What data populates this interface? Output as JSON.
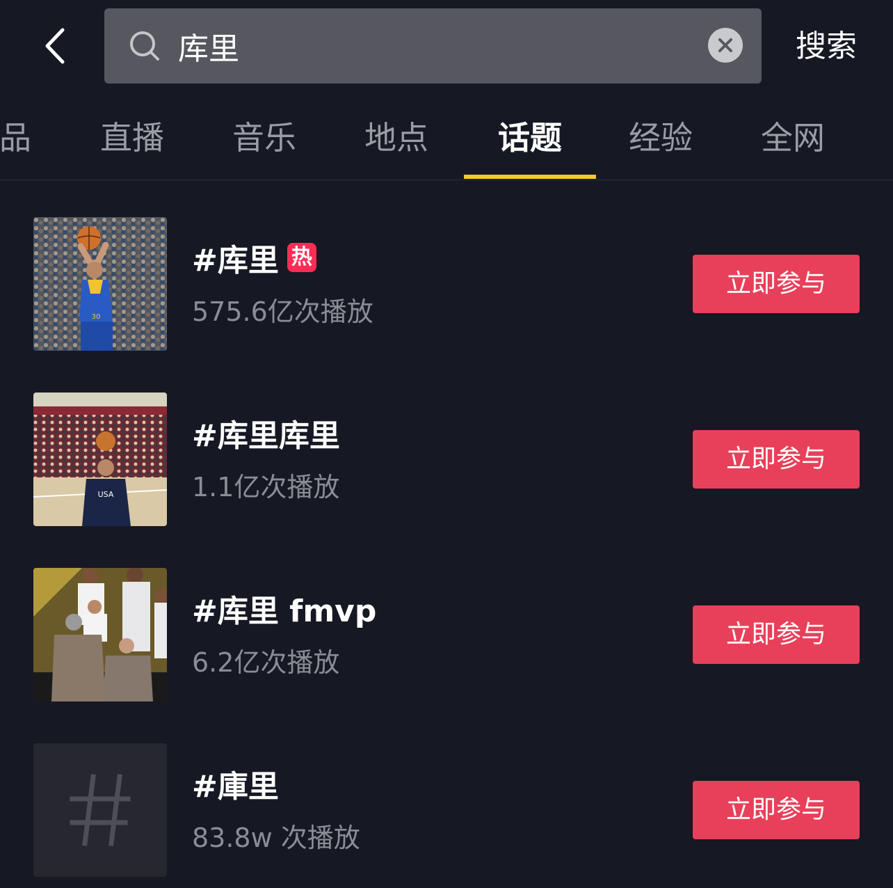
{
  "header": {
    "back_icon": "chevron-left-icon",
    "search_icon": "search-icon",
    "search_value": "库里",
    "clear_icon": "close-circle-icon",
    "submit_label": "搜索"
  },
  "tabs": [
    {
      "label": "品",
      "active": false
    },
    {
      "label": "直播",
      "active": false
    },
    {
      "label": "音乐",
      "active": false
    },
    {
      "label": "地点",
      "active": false
    },
    {
      "label": "话题",
      "active": true
    },
    {
      "label": "经验",
      "active": false
    },
    {
      "label": "全网",
      "active": false
    }
  ],
  "accent": "#f5cb2b",
  "button_color": "#e8405a",
  "topics": [
    {
      "title": "#库里",
      "hot_badge": "热",
      "plays": "575.6亿次播放",
      "join_label": "立即参与",
      "thumb": "curry-shooting-photo"
    },
    {
      "title": "#库里库里",
      "hot_badge": "",
      "plays": "1.1亿次播放",
      "join_label": "立即参与",
      "thumb": "curry-arena-photo"
    },
    {
      "title": "#库里 fmvp",
      "hot_badge": "",
      "plays": "6.2亿次播放",
      "join_label": "立即参与",
      "thumb": "curry-team-photo"
    },
    {
      "title": "#庫里",
      "hot_badge": "",
      "plays": "83.8w 次播放",
      "join_label": "立即参与",
      "thumb": "hashtag-placeholder"
    }
  ]
}
